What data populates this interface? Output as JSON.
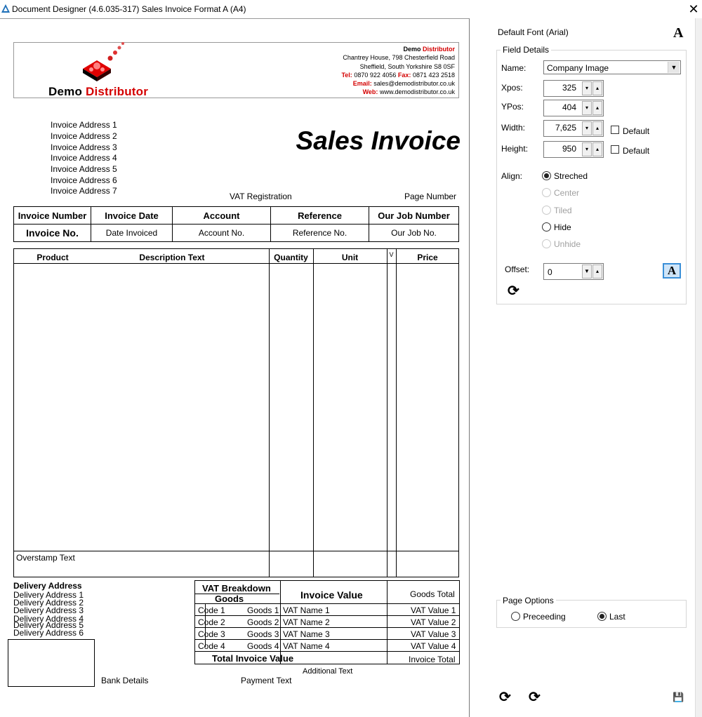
{
  "window": {
    "title": "Document Designer (4.6.035-317) Sales Invoice Format A (A4)",
    "close_glyph": "✕"
  },
  "company": {
    "name_part1": "Demo ",
    "name_part2": "Distributor",
    "block_name1": "Demo ",
    "block_name2": "Distributor",
    "address1": "Chantrey House, 798 Chesterfield Road",
    "address2": "Sheffield, South Yorkshire S8 0SF",
    "tel_label": "Tel:",
    "tel": "0870 922 4056",
    "fax_label": "Fax:",
    "fax": "0871 423 2518",
    "email_label": "Email:",
    "email": "sales@demodistributor.co.uk",
    "web_label": "Web:",
    "web": "www.demodistributor.co.uk"
  },
  "invoice_addresses": [
    "Invoice Address 1",
    "Invoice Address 2",
    "Invoice Address 3",
    "Invoice Address 4",
    "Invoice Address 5",
    "Invoice Address 6",
    "Invoice Address 7"
  ],
  "doc_title": "Sales Invoice",
  "vat_registration": "VAT Registration",
  "page_number": "Page Number",
  "info_table": {
    "headers": [
      "Invoice Number",
      "Invoice Date",
      "Account",
      "Reference",
      "Our Job Number"
    ],
    "values": [
      "Invoice No.",
      "Date Invoiced",
      "Account No.",
      "Reference No.",
      "Our Job No."
    ]
  },
  "lines_table": {
    "headers": {
      "product": "Product",
      "description": "Description Text",
      "quantity": "Quantity",
      "unit": "Unit",
      "vat": "V",
      "price": "Price"
    },
    "overstamp": "Overstamp Text"
  },
  "delivery": {
    "title": "Delivery Address",
    "lines": [
      "Delivery Address 1",
      "Delivery Address 2",
      "Delivery Address 3",
      "Delivery Address 4",
      "Delivery Address 5",
      "Delivery Address 6"
    ]
  },
  "bank_details": "Bank Details",
  "payment_text": "Payment Text",
  "additional_text": "Additional Text",
  "vat_breakdown": {
    "title": "VAT Breakdown",
    "goods_header": "Goods",
    "invoice_value": "Invoice Value",
    "goods_total": "Goods Total",
    "rows": [
      {
        "code": "Code 1",
        "goods": "Goods 1",
        "name": "VAT Name 1",
        "value": "VAT Value 1"
      },
      {
        "code": "Code 2",
        "goods": "Goods 2",
        "name": "VAT Name 2",
        "value": "VAT Value 2"
      },
      {
        "code": "Code 3",
        "goods": "Goods 3",
        "name": "VAT Name 3",
        "value": "VAT Value 3"
      },
      {
        "code": "Code 4",
        "goods": "Goods 4",
        "name": "VAT Name 4",
        "value": "VAT Value 4"
      }
    ],
    "total_label": "Total Invoice Value",
    "invoice_total": "Invoice Total"
  },
  "panel": {
    "default_font": "Default Font (Arial)",
    "field_details": "Field Details",
    "name_label": "Name:",
    "name_value": "Company Image",
    "xpos_label": "Xpos:",
    "xpos_value": "325",
    "ypos_label": "YPos:",
    "ypos_value": "404",
    "width_label": "Width:",
    "width_value": "7,625",
    "height_label": "Height:",
    "height_value": "950",
    "default_label": "Default",
    "align_label": "Align:",
    "align_options": [
      "Streched",
      "Center",
      "Tiled",
      "Hide",
      "Unhide"
    ],
    "offset_label": "Offset:",
    "offset_value": "0",
    "page_options": "Page Options",
    "page_options_items": [
      "Preceeding",
      "Last"
    ]
  },
  "glyphs": {
    "dropdown": "▼",
    "spin_down": "▾",
    "spin_up": "▴",
    "font_A": "A",
    "refresh": "⟳",
    "save": "💾"
  }
}
